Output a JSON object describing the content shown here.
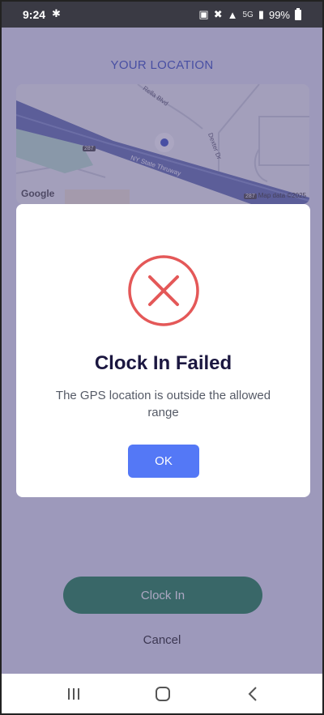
{
  "status_bar": {
    "time": "9:24",
    "network": "5G",
    "battery": "99%"
  },
  "screen": {
    "title": "YOUR LOCATION",
    "map": {
      "google_logo": "Google",
      "attribution": "Map data ©2025",
      "road_labels": [
        "Rella Blvd",
        "NY State Thruway",
        "Dexter Dr"
      ],
      "route_shield": "287"
    },
    "clock_in_label": "Clock In",
    "cancel_label": "Cancel"
  },
  "dialog": {
    "icon": "error-x-icon",
    "title": "Clock In Failed",
    "message": "The GPS location is outside the allowed range",
    "ok_label": "OK"
  },
  "colors": {
    "accent": "#4a5fc6",
    "clock_in": "#2e8a5b",
    "ok_button": "#5478f6",
    "error": "#e45858"
  }
}
